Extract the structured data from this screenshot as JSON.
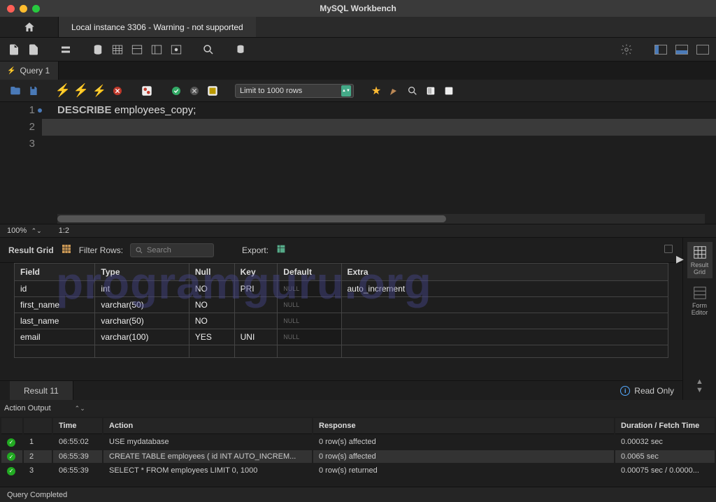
{
  "window": {
    "title": "MySQL Workbench"
  },
  "tabs": {
    "connection": "Local instance 3306 - Warning - not supported"
  },
  "query_tab": {
    "label": "Query 1"
  },
  "editor_toolbar": {
    "limit_label": "Limit to 1000 rows"
  },
  "code": {
    "line1_kw": "DESCRIBE",
    "line1_rest": " employees_copy;"
  },
  "gutter": {
    "l1": "1",
    "l2": "2",
    "l3": "3"
  },
  "zoom": {
    "pct": "100%",
    "pos": "1:2"
  },
  "result_toolbar": {
    "title": "Result Grid",
    "filter_label": "Filter Rows:",
    "filter_placeholder": "Search",
    "export_label": "Export:"
  },
  "watermark": "programguru.org",
  "grid": {
    "headers": [
      "Field",
      "Type",
      "Null",
      "Key",
      "Default",
      "Extra"
    ],
    "rows": [
      {
        "field": "id",
        "type": "int",
        "nul": "NO",
        "key": "PRI",
        "def": "NULL",
        "extra": "auto_increment"
      },
      {
        "field": "first_name",
        "type": "varchar(50)",
        "nul": "NO",
        "key": "",
        "def": "NULL",
        "extra": ""
      },
      {
        "field": "last_name",
        "type": "varchar(50)",
        "nul": "NO",
        "key": "",
        "def": "NULL",
        "extra": ""
      },
      {
        "field": "email",
        "type": "varchar(100)",
        "nul": "YES",
        "key": "UNI",
        "def": "NULL",
        "extra": ""
      }
    ]
  },
  "sidepanel": {
    "result_grid": "Result\nGrid",
    "form_editor": "Form\nEditor"
  },
  "result_tab": {
    "label": "Result 11",
    "readonly": "Read Only"
  },
  "action_output": {
    "label": "Action Output",
    "headers": {
      "num": "",
      "time": "Time",
      "action": "Action",
      "response": "Response",
      "duration": "Duration / Fetch Time"
    },
    "rows": [
      {
        "n": "1",
        "time": "06:55:02",
        "action": "USE mydatabase",
        "response": "0 row(s) affected",
        "duration": "0.00032 sec"
      },
      {
        "n": "2",
        "time": "06:55:39",
        "action": "CREATE TABLE employees (     id INT AUTO_INCREM...",
        "response": "0 row(s) affected",
        "duration": "0.0065 sec"
      },
      {
        "n": "3",
        "time": "06:55:39",
        "action": "SELECT * FROM employees LIMIT 0, 1000",
        "response": "0 row(s) returned",
        "duration": "0.00075 sec / 0.0000..."
      }
    ]
  },
  "status": {
    "text": "Query Completed"
  }
}
